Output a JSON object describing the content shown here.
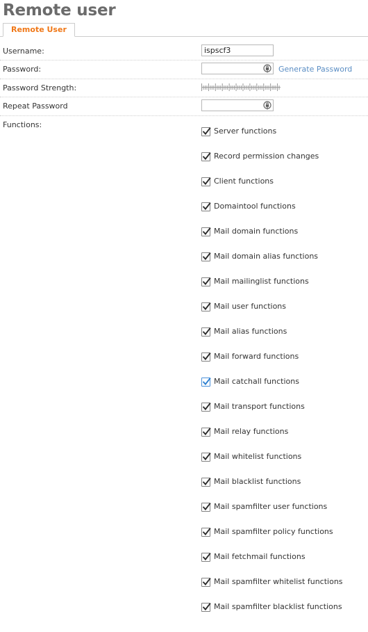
{
  "page": {
    "title": "Remote user"
  },
  "tabs": [
    {
      "label": "Remote User",
      "active": true
    }
  ],
  "form": {
    "username": {
      "label": "Username:",
      "value": "ispscf3",
      "placeholder": ""
    },
    "password": {
      "label": "Password:",
      "value": "",
      "placeholder": "",
      "icon": "lock-icon",
      "generate_link": "Generate Password"
    },
    "password_strength": {
      "label": "Password Strength:",
      "meter_ticks": 46,
      "filled": 0
    },
    "repeat_password": {
      "label": "Repeat Password",
      "value": "",
      "placeholder": "",
      "icon": "lock-icon"
    },
    "functions": {
      "label": "Functions:",
      "items": [
        {
          "label": "Server functions",
          "checked": true,
          "focused": false
        },
        {
          "label": "Record permission changes",
          "checked": true,
          "focused": false
        },
        {
          "label": "Client functions",
          "checked": true,
          "focused": false
        },
        {
          "label": "Domaintool functions",
          "checked": true,
          "focused": false
        },
        {
          "label": "Mail domain functions",
          "checked": true,
          "focused": false
        },
        {
          "label": "Mail domain alias functions",
          "checked": true,
          "focused": false
        },
        {
          "label": "Mail mailinglist functions",
          "checked": true,
          "focused": false
        },
        {
          "label": "Mail user functions",
          "checked": true,
          "focused": false
        },
        {
          "label": "Mail alias functions",
          "checked": true,
          "focused": false
        },
        {
          "label": "Mail forward functions",
          "checked": true,
          "focused": false
        },
        {
          "label": "Mail catchall functions",
          "checked": true,
          "focused": true
        },
        {
          "label": "Mail transport functions",
          "checked": true,
          "focused": false
        },
        {
          "label": "Mail relay functions",
          "checked": true,
          "focused": false
        },
        {
          "label": "Mail whitelist functions",
          "checked": true,
          "focused": false
        },
        {
          "label": "Mail blacklist functions",
          "checked": true,
          "focused": false
        },
        {
          "label": "Mail spamfilter user functions",
          "checked": true,
          "focused": false
        },
        {
          "label": "Mail spamfilter policy functions",
          "checked": true,
          "focused": false
        },
        {
          "label": "Mail fetchmail functions",
          "checked": true,
          "focused": false
        },
        {
          "label": "Mail spamfilter whitelist functions",
          "checked": true,
          "focused": false
        },
        {
          "label": "Mail spamfilter blacklist functions",
          "checked": true,
          "focused": false
        }
      ]
    }
  },
  "colors": {
    "tab_text": "#f07818",
    "title": "#6b6b6b",
    "link": "#5b8ec4",
    "focus_border": "#4a90d9",
    "separator": "#cfcfcf",
    "input_border": "#b8b8b8"
  }
}
